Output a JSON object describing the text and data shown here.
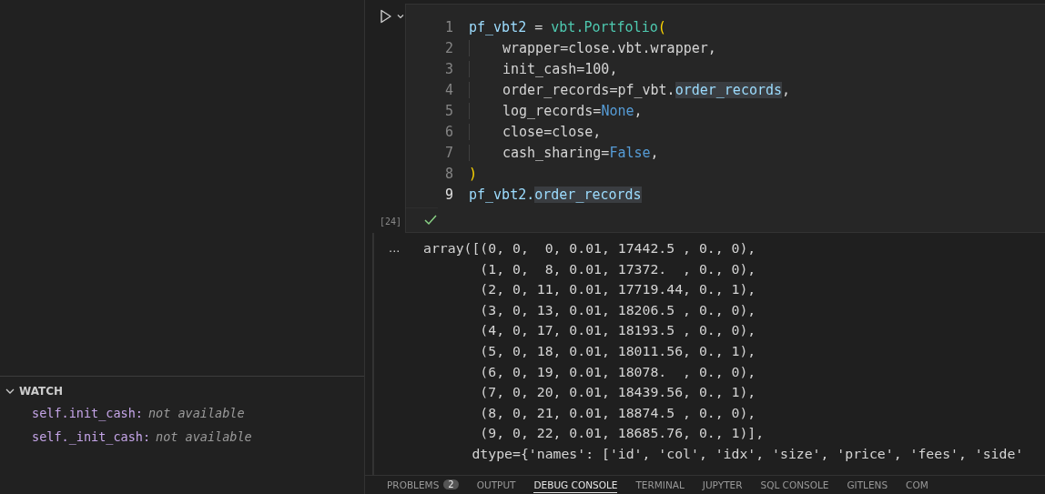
{
  "watch": {
    "title": "WATCH",
    "expanded": true,
    "items": [
      {
        "expression": "self.init_cash:",
        "value": "not available"
      },
      {
        "expression": "self._init_cash:",
        "value": "not available"
      }
    ]
  },
  "cell": {
    "execution_count": "[24]",
    "lines": [
      {
        "number": "1",
        "current": false,
        "indent": false,
        "tokens": [
          {
            "text": "pf_vbt2",
            "kind": "var"
          },
          {
            "text": " = ",
            "kind": "plain"
          },
          {
            "text": "vbt.Portfolio",
            "kind": "class"
          },
          {
            "text": "(",
            "kind": "bracket"
          }
        ]
      },
      {
        "number": "2",
        "current": false,
        "indent": true,
        "tokens": [
          {
            "text": "wrapper=close.vbt.wrapper,",
            "kind": "plain"
          }
        ]
      },
      {
        "number": "3",
        "current": false,
        "indent": true,
        "tokens": [
          {
            "text": "init_cash=100,",
            "kind": "plain"
          }
        ]
      },
      {
        "number": "4",
        "current": false,
        "indent": true,
        "tokens": [
          {
            "text": "order_records=pf_vbt.",
            "kind": "plain"
          },
          {
            "text": "order_records",
            "kind": "highlight"
          },
          {
            "text": ",",
            "kind": "plain"
          }
        ]
      },
      {
        "number": "5",
        "current": false,
        "indent": true,
        "tokens": [
          {
            "text": "log_records=",
            "kind": "plain"
          },
          {
            "text": "None",
            "kind": "const"
          },
          {
            "text": ",",
            "kind": "plain"
          }
        ]
      },
      {
        "number": "6",
        "current": false,
        "indent": true,
        "tokens": [
          {
            "text": "close=close,",
            "kind": "plain"
          }
        ]
      },
      {
        "number": "7",
        "current": false,
        "indent": true,
        "tokens": [
          {
            "text": "cash_sharing=",
            "kind": "plain"
          },
          {
            "text": "False",
            "kind": "const"
          },
          {
            "text": ",",
            "kind": "plain"
          }
        ]
      },
      {
        "number": "8",
        "current": false,
        "indent": false,
        "tokens": [
          {
            "text": ")",
            "kind": "bracket"
          }
        ]
      },
      {
        "number": "9",
        "current": true,
        "indent": false,
        "tokens": [
          {
            "text": "pf_vbt2.",
            "kind": "var"
          },
          {
            "text": "order_records",
            "kind": "highlight"
          }
        ]
      }
    ]
  },
  "output": {
    "more": "...",
    "lines": [
      "array([(0, 0,  0, 0.01, 17442.5 , 0., 0),",
      "       (1, 0,  8, 0.01, 17372.  , 0., 0),",
      "       (2, 0, 11, 0.01, 17719.44, 0., 1),",
      "       (3, 0, 13, 0.01, 18206.5 , 0., 0),",
      "       (4, 0, 17, 0.01, 18193.5 , 0., 0),",
      "       (5, 0, 18, 0.01, 18011.56, 0., 1),",
      "       (6, 0, 19, 0.01, 18078.  , 0., 0),",
      "       (7, 0, 20, 0.01, 18439.56, 0., 1),",
      "       (8, 0, 21, 0.01, 18874.5 , 0., 0),",
      "       (9, 0, 22, 0.01, 18685.76, 0., 1)],",
      "      dtype={'names': ['id', 'col', 'idx', 'size', 'price', 'fees', 'side'"
    ]
  },
  "panel_tabs": [
    {
      "label": "PROBLEMS",
      "badge": "2",
      "selected": false
    },
    {
      "label": "OUTPUT",
      "selected": false
    },
    {
      "label": "DEBUG CONSOLE",
      "selected": true
    },
    {
      "label": "TERMINAL",
      "selected": false
    },
    {
      "label": "JUPYTER",
      "selected": false
    },
    {
      "label": "SQL CONSOLE",
      "selected": false
    },
    {
      "label": "GITLENS",
      "selected": false
    },
    {
      "label": "COM",
      "selected": false
    }
  ]
}
